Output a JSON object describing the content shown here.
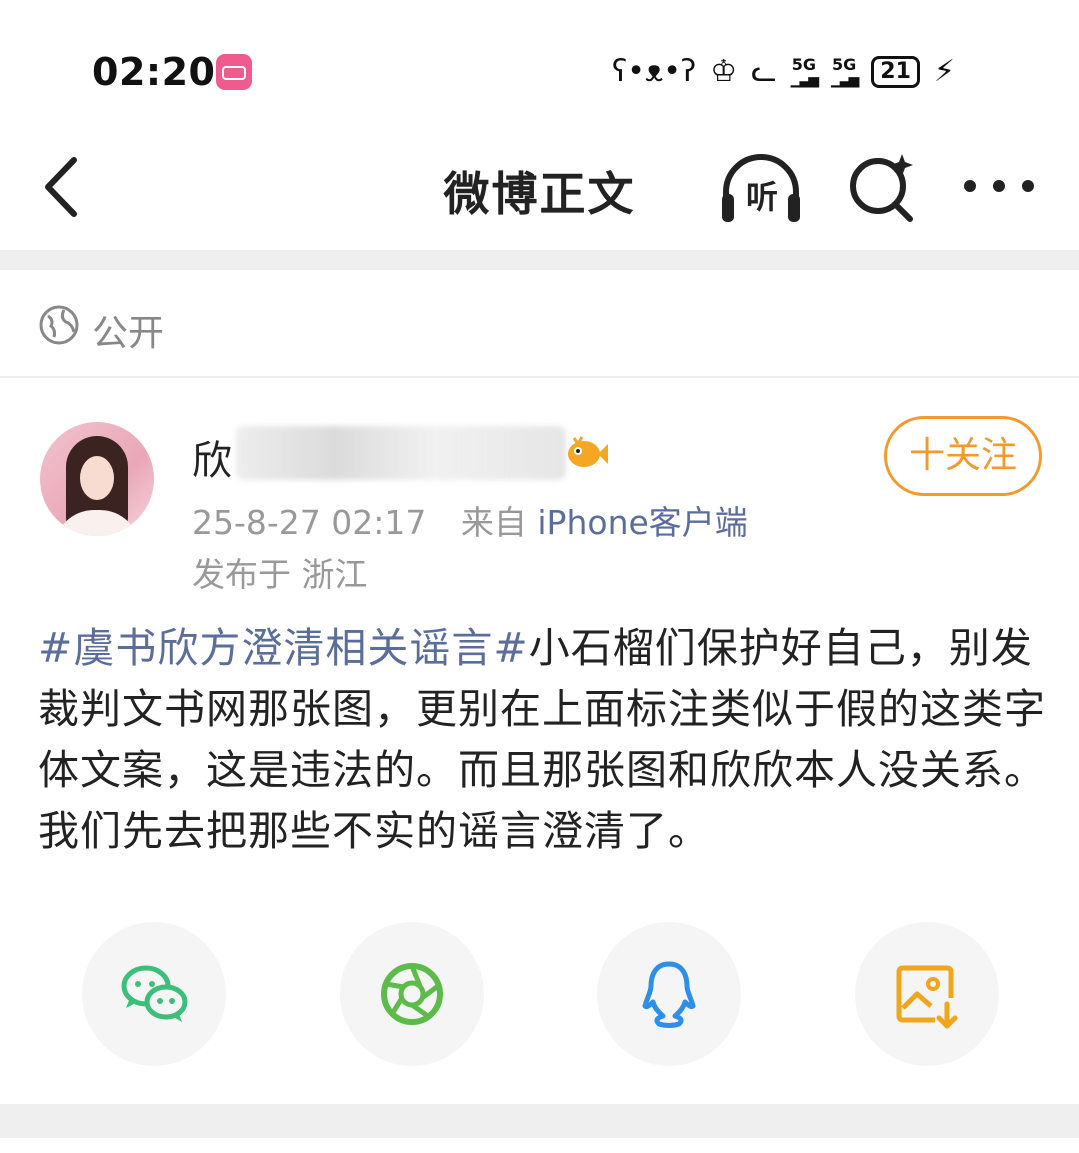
{
  "status_bar": {
    "time": "02:20",
    "network_1": "5G",
    "network_2": "5G",
    "battery": "21",
    "app_icon": "bilibili-icon",
    "icons": [
      "face-icon",
      "crown-face-icon",
      "cat-face-icon",
      "signal-icon",
      "charging-icon"
    ]
  },
  "nav": {
    "title": "微博正文",
    "listen_label": "听",
    "icons": [
      "back-icon",
      "listen-icon",
      "search-icon",
      "more-icon"
    ]
  },
  "visibility": {
    "label": "公开",
    "icon": "globe-icon"
  },
  "author": {
    "name": "欣",
    "timestamp": "25-8-27 02:17",
    "source_prefix": "来自",
    "source": "iPhone客户端",
    "location": "发布于 浙江",
    "follow_label": "十关注"
  },
  "post": {
    "topic": "#虞书欣方澄清相关谣言#",
    "text": "小石榴们保护好自己，别发裁判文书网那张图，更别在上面标注类似于假的这类字体文案，这是违法的。而且那张图和欣欣本人没关系。我们先去把那些不实的谣言澄清了。"
  },
  "share": {
    "items": [
      "wechat-icon",
      "moments-icon",
      "qq-icon",
      "save-image-icon"
    ],
    "colors": {
      "wechat": "#3bbf7b",
      "moments": "#5dbb4a",
      "qq": "#2d8fe8",
      "save": "#f0a51c"
    }
  },
  "colors": {
    "accent": "#f29a2e",
    "link": "#5b6e99"
  }
}
